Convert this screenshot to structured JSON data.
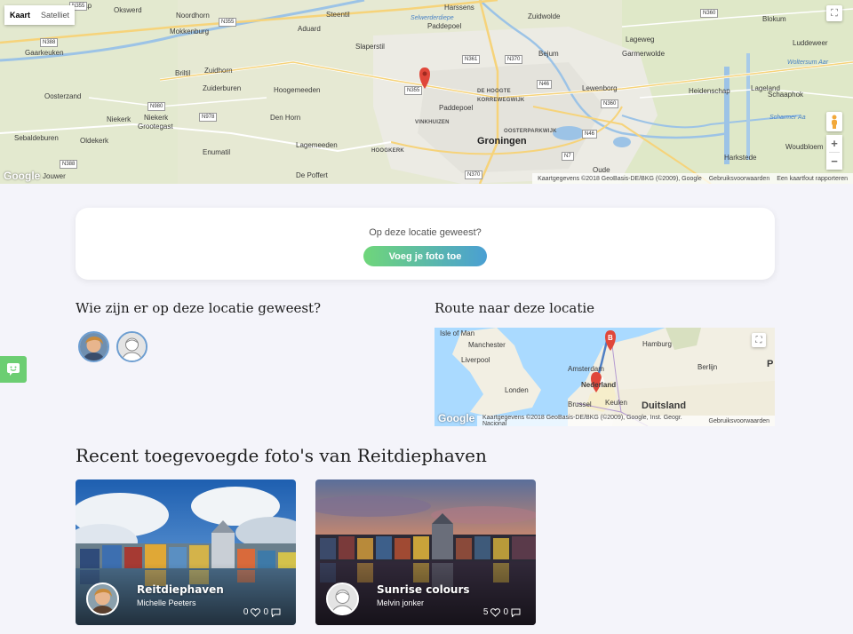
{
  "top_map": {
    "type_controls": {
      "map": "Kaart",
      "satellite": "Satelliet"
    },
    "attribution": [
      "Kaartgegevens ©2018 GeoBasis-DE/BKG (©2009), Google",
      "Gebruiksvoorwaarden",
      "Een kaartfout rapporteren"
    ],
    "logo": "Google",
    "labels": {
      "nietap": "Nietap",
      "okswerd": "Okswerd",
      "noordhorn": "Noordhorn",
      "steentil": "Steentil",
      "harssens": "Harssens",
      "zuidwolde": "Zuidwolde",
      "mokkenburg": "Mokkenburg",
      "aduard": "Aduard",
      "selwerderdiepe": "Selwerderdiepe",
      "paddepoel_n": "Paddepoel",
      "blokum": "Blokum",
      "garkeuken": "Gaarkeuken",
      "brilti": "Briltil",
      "zuidhorn": "Zuidhorn",
      "slaperstil": "Slaperstil",
      "bejum": "Bejum",
      "lageweg": "Lageweg",
      "garmerwolde": "Garmerwolde",
      "luddeweer": "Luddeweer",
      "woltersum": "Woltersum Aar",
      "zuiderburen": "Zuiderburen",
      "hoogemeeden": "Hoogemeeden",
      "dehoogte": "DE HOOGTE",
      "lewenborg": "Lewenborg",
      "heidenschap": "Heidenschap",
      "lageland": "Lageland",
      "oosterzand": "Oosterzand",
      "korrewegwijk": "KORREWEGWIJK",
      "paddepoel": "Paddepoel",
      "schaaphok": "Schaaphok",
      "niekerk1": "Niekerk",
      "niekerk2": "Niekerk",
      "grootegast": "Grootegast",
      "denhorn": "Den Horn",
      "vinkhuizen": "VINKHUIZEN",
      "scharmer": "Scharmer Aa",
      "sebaldeburen": "Sebaldeburen",
      "oldekerk": "Oldekerk",
      "oosterparkwijk": "OOSTERPARKWIJK",
      "groningen": "Groningen",
      "lagemeeden": "Lagemeeden",
      "woudbloem": "Woudbloem",
      "enumatil": "Enumatil",
      "hoogkerk": "HOOGKERK",
      "harkstede": "Harkstede",
      "jouwer": "Jouwer",
      "depoffert": "De Poffert",
      "oude": "Oude"
    },
    "roads": [
      "N355",
      "N388",
      "N355",
      "N361",
      "N370",
      "N46",
      "N355",
      "N980",
      "N978",
      "N360",
      "N360",
      "N46",
      "N7",
      "N388",
      "N370"
    ]
  },
  "upload": {
    "question": "Op deze locatie geweest?",
    "button": "Voeg je foto toe"
  },
  "visitors": {
    "title": "Wie zijn er op deze locatie geweest?"
  },
  "route": {
    "title": "Route naar deze locatie",
    "labels": {
      "isle": "Isle of Man",
      "manchester": "Manchester",
      "liverpool": "Liverpool",
      "hamburg": "Hamburg",
      "amsterdam": "Amsterdam",
      "nederland": "Nederland",
      "berlijn": "Berlijn",
      "londen": "Londen",
      "brussel": "Brussel",
      "keulen": "Keulen",
      "duitsland": "Duitsland",
      "p": "P"
    },
    "markers": {
      "a": "A",
      "b": "B"
    },
    "logo": "Google",
    "attribution": [
      "Kaartgegevens ©2018 GeoBasis-DE/BKG (©2009), Google, Inst. Geogr. Nacional",
      "Gebruiksvoorwaarden"
    ]
  },
  "photos": {
    "title": "Recent toegevoegde foto's van Reitdiephaven",
    "items": [
      {
        "title": "Reitdiephaven",
        "author": "Michelle Peeters",
        "likes": "0",
        "comments": "0"
      },
      {
        "title": "Sunrise colours",
        "author": "Melvin jonker",
        "likes": "5",
        "comments": "0"
      }
    ]
  },
  "colors": {
    "accent_green": "#6fd67a",
    "accent_blue": "#4a9fd3",
    "avatar_border": "#6d9ed1"
  }
}
